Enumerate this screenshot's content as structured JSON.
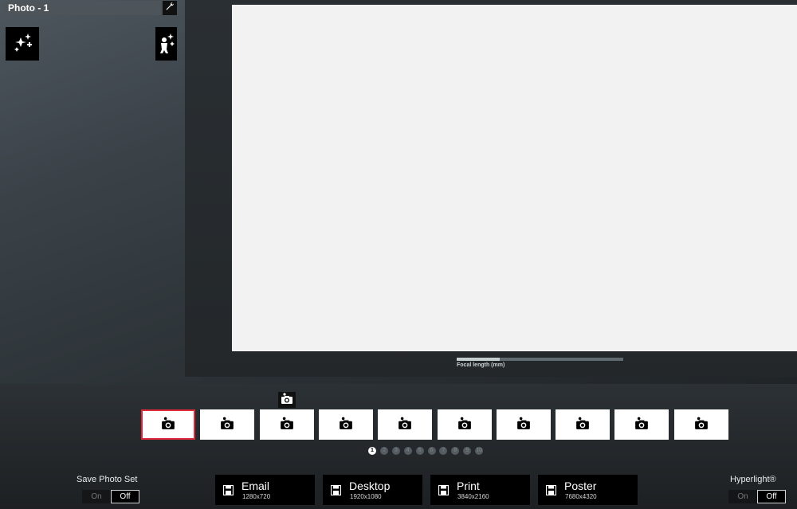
{
  "panel": {
    "title": "Photo - 1",
    "settings_icon": "wrench-icon",
    "effect_icon": "sparkle-stars-icon",
    "wizard_icon": "person-stars-icon"
  },
  "stage": {
    "focal_label": "Focal length (mm)",
    "focal_value_fraction": 0.26
  },
  "capture": {
    "icon": "camera-icon"
  },
  "thumbnails": [
    {
      "selected": true
    },
    {
      "selected": false
    },
    {
      "selected": false
    },
    {
      "selected": false
    },
    {
      "selected": false
    },
    {
      "selected": false
    },
    {
      "selected": false
    },
    {
      "selected": false
    },
    {
      "selected": false
    },
    {
      "selected": false
    }
  ],
  "pages": [
    "1",
    "2",
    "3",
    "4",
    "5",
    "6",
    "7",
    "8",
    "9",
    "10"
  ],
  "active_page": 1,
  "save_photo_set": {
    "label": "Save Photo Set",
    "on": "On",
    "off": "Off",
    "selected": "Off"
  },
  "hyperlight": {
    "label": "Hyperlight®",
    "on": "On",
    "off": "Off",
    "selected": "Off"
  },
  "exports": [
    {
      "title": "Email",
      "size": "1280x720"
    },
    {
      "title": "Desktop",
      "size": "1920x1080"
    },
    {
      "title": "Print",
      "size": "3840x2160"
    },
    {
      "title": "Poster",
      "size": "7680x4320"
    }
  ],
  "colors": {
    "selected_border": "#e0283b",
    "canvas": "#f2f2f2"
  }
}
